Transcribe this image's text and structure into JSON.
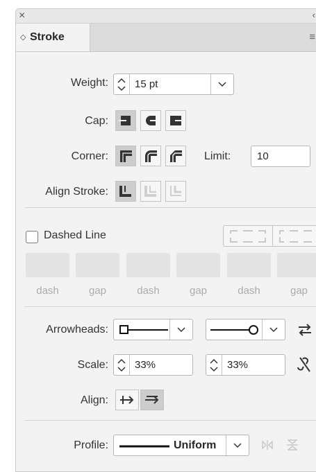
{
  "panel": {
    "tab_title": "Stroke",
    "menu_icon": "hamburger-menu-icon"
  },
  "weight": {
    "label": "Weight:",
    "value": "15 pt"
  },
  "cap": {
    "label": "Cap:",
    "options": [
      "butt-cap-icon",
      "round-cap-icon",
      "projecting-cap-icon"
    ],
    "selected": 0
  },
  "corner": {
    "label": "Corner:",
    "options": [
      "miter-join-icon",
      "round-join-icon",
      "bevel-join-icon"
    ],
    "selected": 0
  },
  "limit": {
    "label": "Limit:",
    "value": "10"
  },
  "align_stroke": {
    "label": "Align Stroke:",
    "options": [
      "align-center-icon",
      "align-inside-icon",
      "align-outside-icon"
    ],
    "selected": 0
  },
  "dashed_line": {
    "label": "Dashed Line",
    "checked": false,
    "fields": [
      "dash",
      "gap",
      "dash",
      "gap",
      "dash",
      "gap"
    ]
  },
  "arrowheads": {
    "label": "Arrowheads:"
  },
  "scale": {
    "label": "Scale:",
    "start": "33%",
    "end": "33%"
  },
  "align": {
    "label": "Align:"
  },
  "profile": {
    "label": "Profile:",
    "value": "Uniform"
  },
  "colors": {
    "panel_bg": "#f3f3f3",
    "selected_button": "#cdcdcd",
    "icon_dark": "#333333"
  }
}
